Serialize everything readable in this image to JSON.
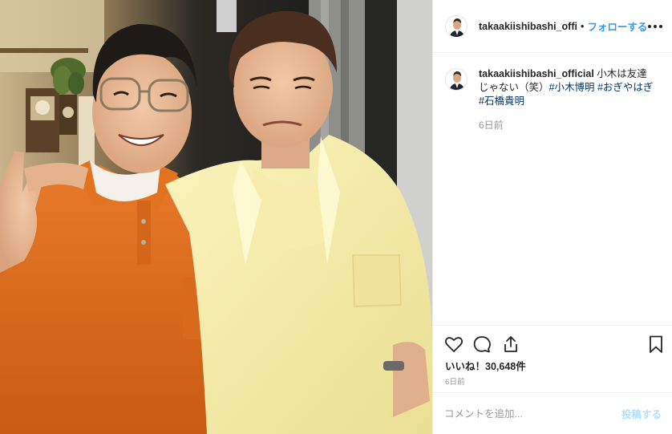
{
  "post": {
    "username": "takaakiishibashi_official",
    "username_truncated": "takaakiishibashi_offi",
    "header_dot": "•",
    "follow_label": "フォローする",
    "more_icon": "more-horizontal-icon",
    "caption": {
      "text": "小木は友達じゃない（笑）",
      "hashtags": [
        "#小木博明",
        "#おぎやはぎ",
        "#石橋貴明"
      ],
      "time": "6日前"
    },
    "actions": {
      "like_icon": "heart-icon",
      "comment_icon": "comment-icon",
      "share_icon": "share-icon",
      "save_icon": "bookmark-icon"
    },
    "likes_label": "いいね！30,648件",
    "post_time": "6日前",
    "comment_placeholder": "コメントを追加...",
    "post_button_label": "投稿する"
  },
  "colors": {
    "link_blue": "#3897f0",
    "hashtag": "#003569",
    "muted": "#999999",
    "border": "#efefef",
    "post_disabled": "#b2dffc"
  }
}
